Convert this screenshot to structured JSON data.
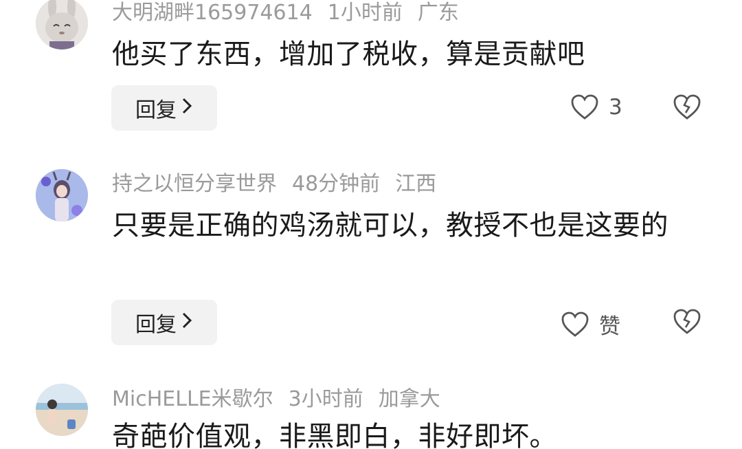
{
  "comments": [
    {
      "username": "大明湖畔165974614",
      "time": "1小时前",
      "location": "广东",
      "text": "他买了东西，增加了税收，算是贡献吧",
      "reply_label": "回复",
      "like_count": "3"
    },
    {
      "username": "持之以恒分享世界",
      "time": "48分钟前",
      "location": "江西",
      "text": "只要是正确的鸡汤就可以，教授不也是这要的",
      "reply_label": "回复",
      "like_count": "赞"
    },
    {
      "username": "MicHELLE米歇尔",
      "time": "3小时前",
      "location": "加拿大",
      "text": "奇葩价值观，非黑即白，非好即坏。"
    }
  ],
  "icons": {
    "like": "heart-outline-icon",
    "dislike": "broken-heart-icon",
    "reply_arrow": "chevron-right-icon"
  },
  "colors": {
    "meta_text": "#9a9a9a",
    "body_text": "#1a1a1a",
    "reply_bg": "#f2f2f2"
  }
}
